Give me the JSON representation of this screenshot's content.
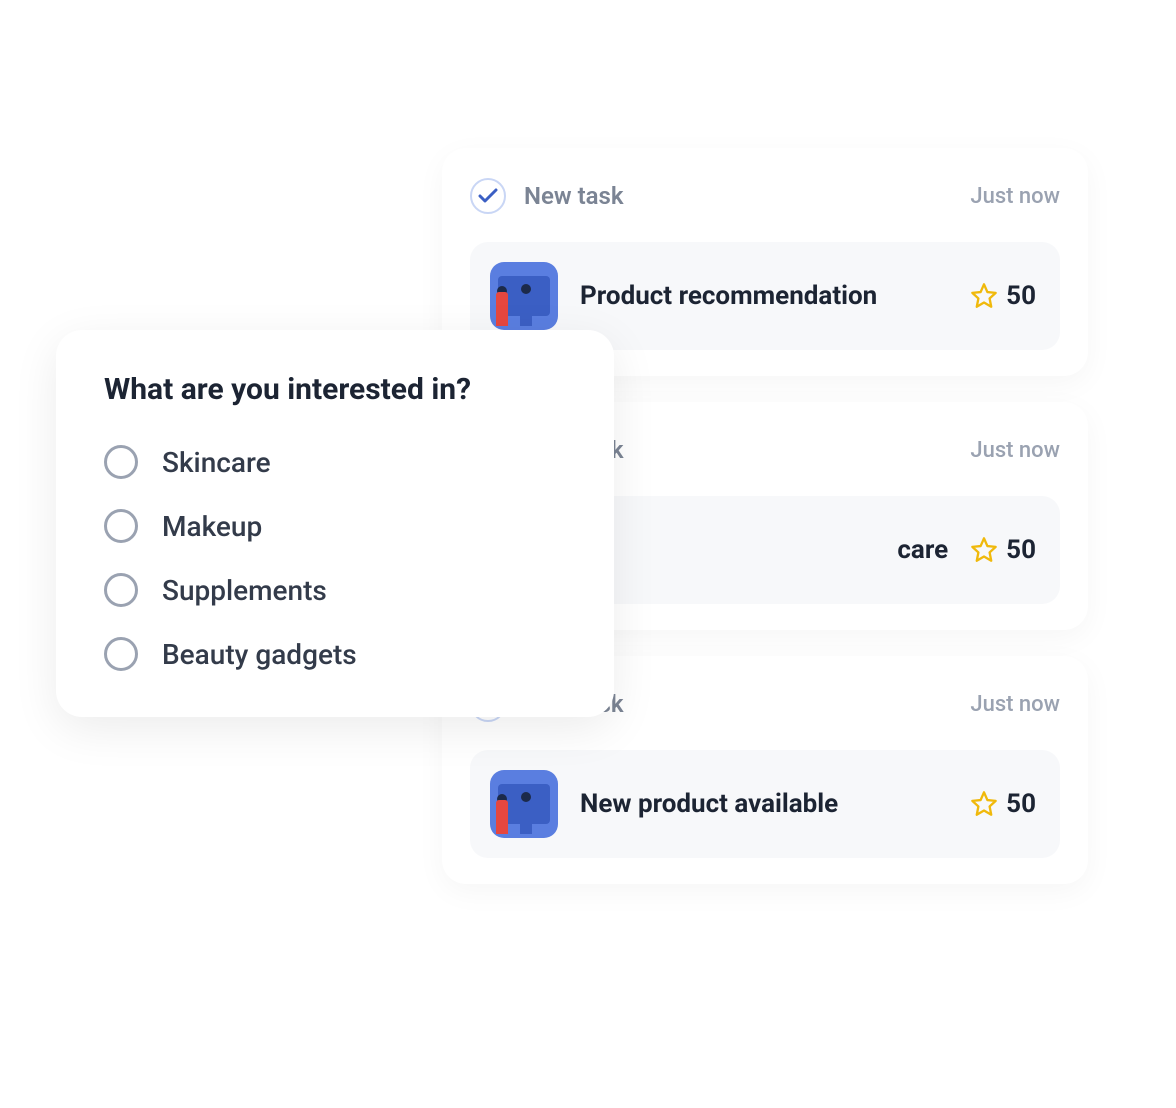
{
  "tasks": [
    {
      "header_label": "New task",
      "time": "Just now",
      "title": "Product recommendation",
      "points": "50"
    },
    {
      "header_label": "New task",
      "time": "Just now",
      "title": "care",
      "points": "50"
    },
    {
      "header_label": "New task",
      "time": "Just now",
      "title": "New product available",
      "points": "50"
    }
  ],
  "interest": {
    "title": "What are you interested in?",
    "options": [
      "Skincare",
      "Makeup",
      "Supplements",
      "Beauty gadgets"
    ]
  }
}
